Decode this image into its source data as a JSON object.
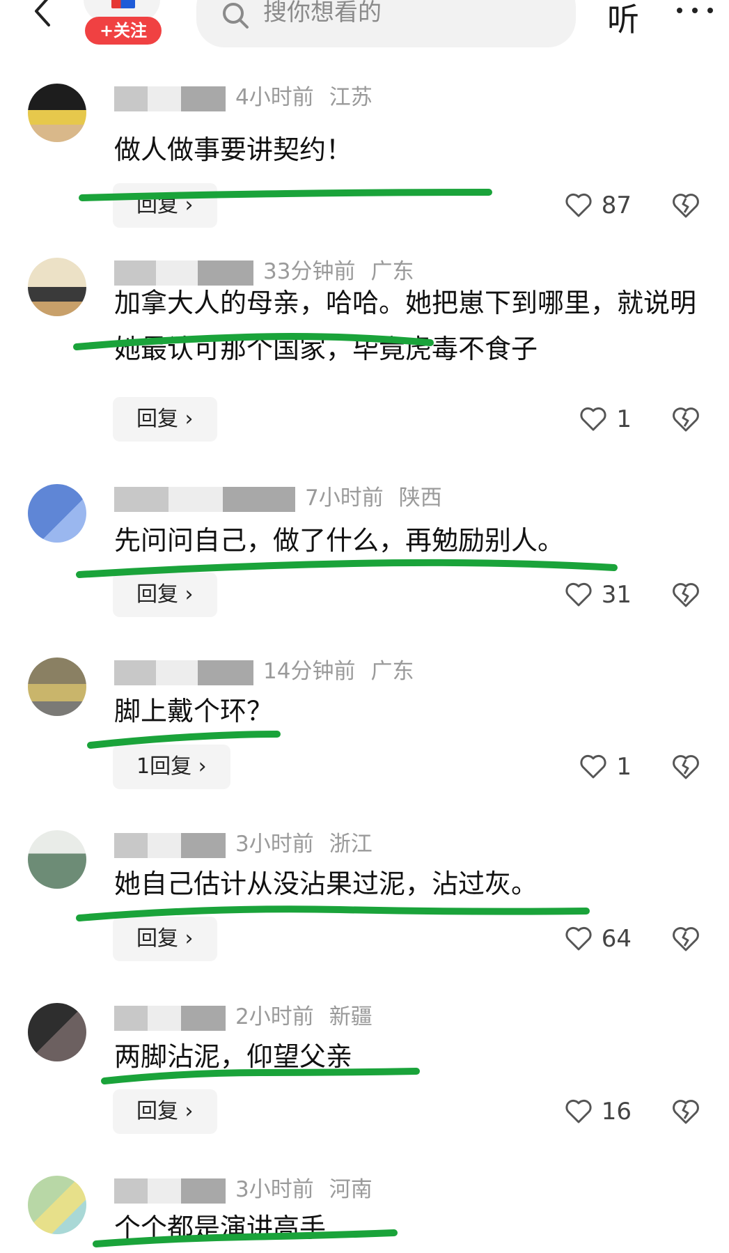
{
  "header": {
    "follow_label": "+关注",
    "search_placeholder": "搜你想看的",
    "listen_label": "听"
  },
  "comments": [
    {
      "time": "4小时前",
      "location": "江苏",
      "text": "做人做事要讲契约！",
      "reply_label": "回复 ›",
      "likes": "87"
    },
    {
      "time": "33分钟前",
      "location": "广东",
      "text": "加拿大人的母亲，哈哈。她把崽下到哪里，就说明她最认可那个国家，毕竟虎毒不食子",
      "reply_label": "回复 ›",
      "likes": "1"
    },
    {
      "time": "7小时前",
      "location": "陕西",
      "text": "先问问自己，做了什么，再勉励别人。",
      "reply_label": "回复 ›",
      "likes": "31"
    },
    {
      "time": "14分钟前",
      "location": "广东",
      "text": "脚上戴个环？",
      "reply_label": "1回复 ›",
      "likes": "1"
    },
    {
      "time": "3小时前",
      "location": "浙江",
      "text": "她自己估计从没沾果过泥，沾过灰。",
      "reply_label": "回复 ›",
      "likes": "64"
    },
    {
      "time": "2小时前",
      "location": "新疆",
      "text": "两脚沾泥，仰望父亲",
      "reply_label": "回复 ›",
      "likes": "16"
    },
    {
      "time": "3小时前",
      "location": "河南",
      "text": "个个都是演讲高手"
    }
  ],
  "colors": {
    "accent_red": "#f04142",
    "highlight_green": "#1aa33a"
  },
  "icons": {
    "back": "back-arrow-icon",
    "search": "search-icon",
    "more": "more-icon",
    "like": "heart-icon",
    "dislike": "broken-heart-icon"
  }
}
